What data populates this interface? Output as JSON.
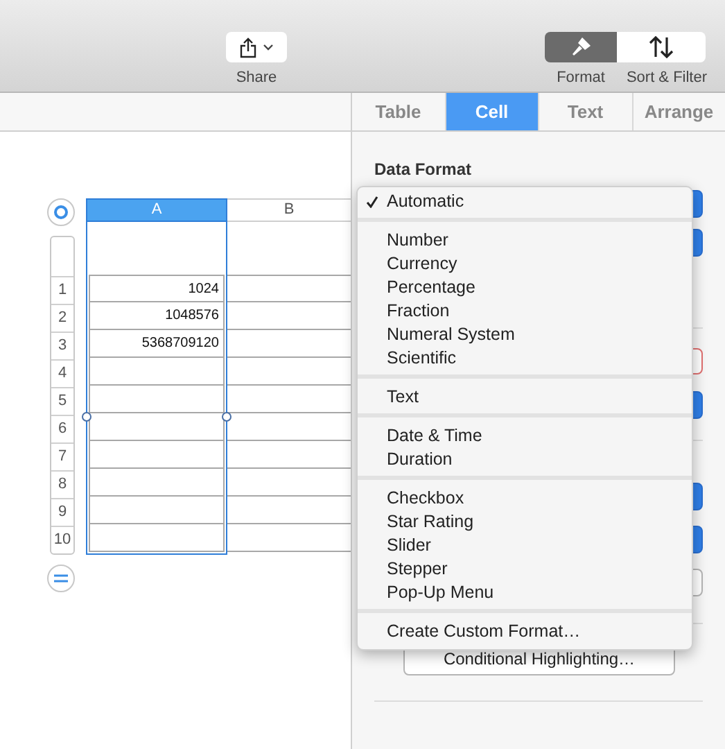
{
  "toolbar": {
    "share": {
      "label": "Share"
    },
    "views": [
      {
        "label": "Format",
        "selected": true,
        "kind": "brush"
      },
      {
        "label": "Sort & Filter",
        "selected": false,
        "kind": "sort"
      }
    ]
  },
  "tabs": [
    {
      "label": "Table",
      "selected": false
    },
    {
      "label": "Cell",
      "selected": true
    },
    {
      "label": "Text",
      "selected": false
    },
    {
      "label": "Arrange",
      "selected": false
    }
  ],
  "table": {
    "columns": [
      {
        "label": "A",
        "selected": true
      },
      {
        "label": "B",
        "selected": false
      }
    ],
    "rows": [
      {
        "number": "1",
        "value": "1024"
      },
      {
        "number": "2",
        "value": "1048576"
      },
      {
        "number": "3",
        "value": "5368709120"
      },
      {
        "number": "4",
        "value": ""
      },
      {
        "number": "5",
        "value": ""
      },
      {
        "number": "6",
        "value": ""
      },
      {
        "number": "7",
        "value": ""
      },
      {
        "number": "8",
        "value": ""
      },
      {
        "number": "9",
        "value": ""
      },
      {
        "number": "10",
        "value": ""
      }
    ]
  },
  "sidebar": {
    "title": "Data Format",
    "button": "Conditional Highlighting…"
  },
  "menu": {
    "sections": [
      [
        {
          "label": "Automatic",
          "checked": true
        }
      ],
      [
        {
          "label": "Number",
          "checked": false
        },
        {
          "label": "Currency",
          "checked": false
        },
        {
          "label": "Percentage",
          "checked": false
        },
        {
          "label": "Fraction",
          "checked": false
        },
        {
          "label": "Numeral System",
          "checked": false
        },
        {
          "label": "Scientific",
          "checked": false
        }
      ],
      [
        {
          "label": "Text",
          "checked": false
        }
      ],
      [
        {
          "label": "Date & Time",
          "checked": false
        },
        {
          "label": "Duration",
          "checked": false
        }
      ],
      [
        {
          "label": "Checkbox",
          "checked": false
        },
        {
          "label": "Star Rating",
          "checked": false
        },
        {
          "label": "Slider",
          "checked": false
        },
        {
          "label": "Stepper",
          "checked": false
        },
        {
          "label": "Pop-Up Menu",
          "checked": false
        }
      ],
      [
        {
          "label": "Create Custom Format…",
          "checked": false
        }
      ]
    ]
  }
}
